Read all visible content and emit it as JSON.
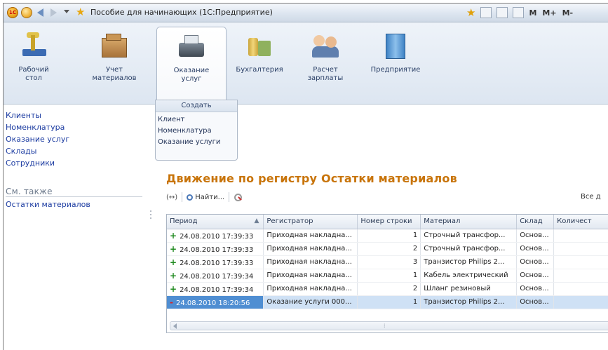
{
  "window": {
    "title": "Пособие для начинающих  (1С:Предприятие)",
    "right_buttons": [
      "M",
      "M+",
      "M-"
    ]
  },
  "sections": [
    {
      "label": "Рабочий\nстол",
      "icon": "desktop-icon"
    },
    {
      "label": "Учет\nматериалов",
      "icon": "boxes-icon"
    },
    {
      "label": "Оказание\nуслуг",
      "icon": "cash-register-icon",
      "active": true
    },
    {
      "label": "Бухгалтерия",
      "icon": "coins-icon"
    },
    {
      "label": "Расчет\nзарплаты",
      "icon": "people-icon"
    },
    {
      "label": "Предприятие",
      "icon": "building-icon"
    }
  ],
  "nav": {
    "items": [
      "Клиенты",
      "Номенклатура",
      "Оказание услуг",
      "Склады",
      "Сотрудники"
    ],
    "see_also_title": "См. также",
    "see_also": [
      "Остатки материалов"
    ]
  },
  "create_panel": {
    "title": "Создать",
    "items": [
      "Клиент",
      "Номенклатура",
      "Оказание услуги"
    ]
  },
  "main": {
    "title": "Движение по регистру Остатки материалов",
    "toolbar": {
      "find_label": "Найти...",
      "all_label": "Все д"
    },
    "table": {
      "columns": [
        "Период",
        "Регистратор",
        "Номер строки",
        "Материал",
        "Склад",
        "Количест"
      ],
      "rows": [
        {
          "sign": "+",
          "period": "24.08.2010 17:39:33",
          "registrar": "Приходная накладна...",
          "line": "1",
          "material": "Строчный трансфор...",
          "warehouse": "Основ...",
          "qty": ""
        },
        {
          "sign": "+",
          "period": "24.08.2010 17:39:33",
          "registrar": "Приходная накладна...",
          "line": "2",
          "material": "Строчный трансфор...",
          "warehouse": "Основ...",
          "qty": ""
        },
        {
          "sign": "+",
          "period": "24.08.2010 17:39:33",
          "registrar": "Приходная накладна...",
          "line": "3",
          "material": "Транзистор Philips 2...",
          "warehouse": "Основ...",
          "qty": ""
        },
        {
          "sign": "+",
          "period": "24.08.2010 17:39:34",
          "registrar": "Приходная накладна...",
          "line": "1",
          "material": "Кабель электрический",
          "warehouse": "Основ...",
          "qty": ""
        },
        {
          "sign": "+",
          "period": "24.08.2010 17:39:34",
          "registrar": "Приходная накладна...",
          "line": "2",
          "material": "Шланг резиновый",
          "warehouse": "Основ...",
          "qty": ""
        },
        {
          "sign": "-",
          "period": "24.08.2010 18:20:56",
          "registrar": "Оказание услуги 000...",
          "line": "1",
          "material": "Транзистор Philips 2...",
          "warehouse": "Основ...",
          "qty": "",
          "selected": true
        }
      ]
    }
  },
  "colors": {
    "accent_title": "#c8740a",
    "link": "#1a3aa0",
    "selection": "#4f8ed2"
  }
}
